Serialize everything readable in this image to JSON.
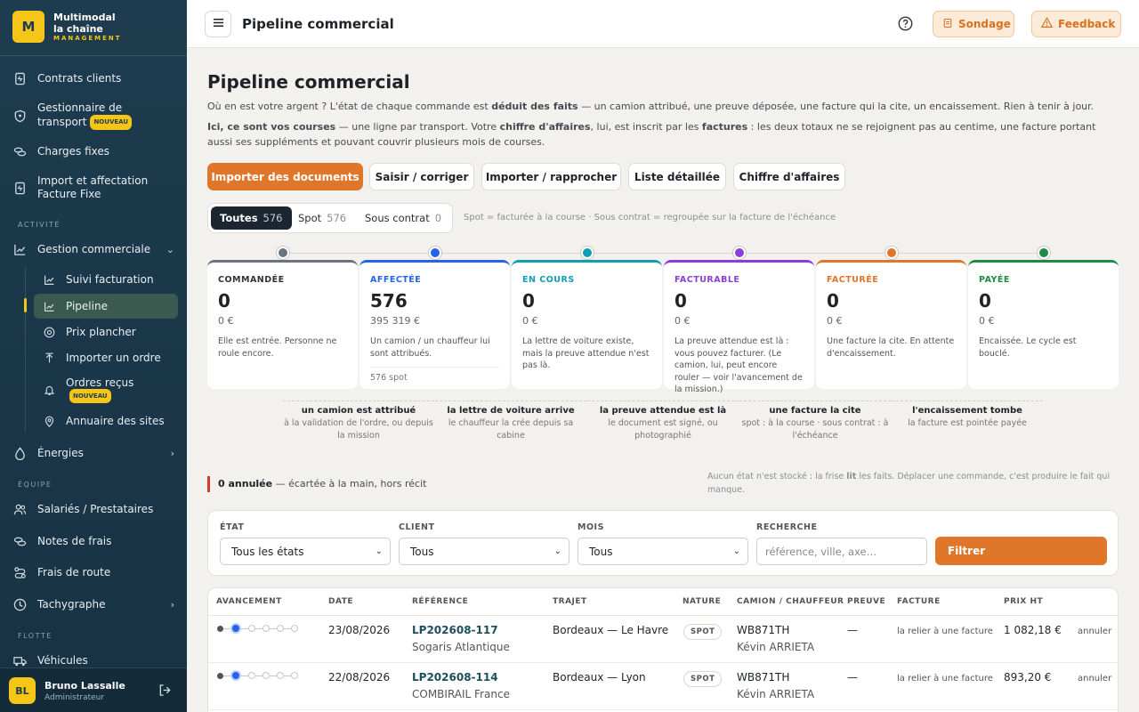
{
  "sidebar": {
    "logo": {
      "mark": "M",
      "line1": "Multimodal",
      "line2": "la chaîne",
      "line3": "MANAGEMENT"
    },
    "top_items": [
      {
        "label": "Contrats clients"
      },
      {
        "label": "Gestionnaire de transport",
        "badge": "NOUVEAU"
      },
      {
        "label": "Charges fixes"
      },
      {
        "label": "Import et affectation Facture Fixe"
      }
    ],
    "section_activite": "ACTIVITÉ",
    "gestion_commerciale": "Gestion commerciale",
    "sub_items": [
      {
        "label": "Suivi facturation"
      },
      {
        "label": "Pipeline"
      },
      {
        "label": "Prix plancher"
      },
      {
        "label": "Importer un ordre"
      },
      {
        "label": "Ordres reçus",
        "badge": "NOUVEAU"
      },
      {
        "label": "Annuaire des sites"
      }
    ],
    "energies": "Énergies",
    "section_equipe": "ÉQUIPE",
    "equipe_items": [
      {
        "label": "Salariés / Prestataires"
      },
      {
        "label": "Notes de frais"
      },
      {
        "label": "Frais de route"
      },
      {
        "label": "Tachygraphe"
      }
    ],
    "section_flotte": "FLOTTE",
    "vehicules": "Véhicules",
    "user": {
      "initials": "BL",
      "name": "Bruno Lassalle",
      "role": "Administrateur"
    }
  },
  "topbar": {
    "title": "Pipeline commercial",
    "sondage": "Sondage",
    "feedback": "Feedback"
  },
  "page": {
    "title": "Pipeline commercial",
    "intro_1a": "Où en est votre argent ? L'état de chaque commande est ",
    "intro_1b": "déduit des faits",
    "intro_1c": " — un camion attribué, une preuve déposée, une facture qui la cite, un encaissement. Rien à tenir à jour.",
    "intro_2a": "Ici, ce sont vos courses",
    "intro_2b": " — une ligne par transport. Votre ",
    "intro_2c": "chiffre d'affaires",
    "intro_2d": ", lui, est inscrit par les ",
    "intro_2e": "factures",
    "intro_2f": " : les deux totaux ne se rejoignent pas au centime, une facture portant aussi ses suppléments et pouvant couvrir plusieurs mois de courses.",
    "actions": [
      "Importer des documents",
      "Saisir / corriger",
      "Importer / rapprocher",
      "Liste détaillée",
      "Chiffre d'affaires"
    ],
    "segments": [
      {
        "label": "Toutes",
        "count": "576"
      },
      {
        "label": "Spot",
        "count": "576"
      },
      {
        "label": "Sous contrat",
        "count": "0"
      }
    ],
    "segment_note": "Spot = facturée à la course · Sous contrat = regroupée sur la facture de l'échéance",
    "stages": [
      {
        "status": "COMMANDÉE",
        "count": "0",
        "amount": "0 €",
        "desc": "Elle est entrée. Personne ne roule encore.",
        "color": "#6b7280"
      },
      {
        "status": "AFFECTÉE",
        "count": "576",
        "amount": "395 319 €",
        "desc": "Un camion / un chauffeur lui sont attribués.",
        "extra": "576 spot",
        "color": "#2563eb"
      },
      {
        "status": "EN COURS",
        "count": "0",
        "amount": "0 €",
        "desc": "La lettre de voiture existe, mais la preuve attendue n'est pas là.",
        "color": "#0e9fb4"
      },
      {
        "status": "FACTURABLE",
        "count": "0",
        "amount": "0 €",
        "desc": "La preuve attendue est là : vous pouvez facturer. (Le camion, lui, peut encore rouler — voir l'avancement de la mission.)",
        "color": "#8b3fd9"
      },
      {
        "status": "FACTURÉE",
        "count": "0",
        "amount": "0 €",
        "desc": "Une facture la cite. En attente d'encaissement.",
        "color": "#e0762a"
      },
      {
        "status": "PAYÉE",
        "count": "0",
        "amount": "0 €",
        "desc": "Encaissée. Le cycle est bouclé.",
        "color": "#1e8a45"
      }
    ],
    "transitions": [
      {
        "title": "un camion est attribué",
        "desc": "à la validation de l'ordre, ou depuis la mission"
      },
      {
        "title": "la lettre de voiture arrive",
        "desc": "le chauffeur la crée depuis sa cabine"
      },
      {
        "title": "la preuve attendue est là",
        "desc": "le document est signé, ou photographié"
      },
      {
        "title": "une facture la cite",
        "desc": "spot : à la course · sous contrat : à l'échéance"
      },
      {
        "title": "l'encaissement tombe",
        "desc": "la facture est pointée payée"
      }
    ],
    "cancelled_count": "0 annulée",
    "cancelled_desc": " — écartée à la main, hors récit",
    "note_right_a": "Aucun état n'est stocké : la frise ",
    "note_right_b": "lit",
    "note_right_c": " les faits. Déplacer une commande, c'est produire le fait qui manque."
  },
  "filters": {
    "etat_label": "ÉTAT",
    "etat_value": "Tous les états",
    "client_label": "CLIENT",
    "client_value": "Tous",
    "mois_label": "MOIS",
    "mois_value": "Tous",
    "recherche_label": "RECHERCHE",
    "recherche_placeholder": "référence, ville, axe…",
    "button": "Filtrer"
  },
  "table": {
    "headers": [
      "AVANCEMENT",
      "DATE",
      "RÉFÉRENCE",
      "TRAJET",
      "NATURE",
      "CAMION / CHAUFFEUR",
      "PREUVE",
      "FACTURE",
      "PRIX HT"
    ],
    "rows": [
      {
        "date": "23/08/2026",
        "ref": "LP202608-117",
        "client": "Sogaris Atlantique",
        "trajet": "Bordeaux — Le Havre",
        "nature": "SPOT",
        "camion": "WB871TH",
        "chauffeur": "Kévin ARRIETA",
        "preuve": "—",
        "facture": "la relier à une facture",
        "prix": "1 082,18 €",
        "action": "annuler"
      },
      {
        "date": "22/08/2026",
        "ref": "LP202608-114",
        "client": "COMBIRAIL France",
        "trajet": "Bordeaux — Lyon",
        "nature": "SPOT",
        "camion": "WB871TH",
        "chauffeur": "Kévin ARRIETA",
        "preuve": "—",
        "facture": "la relier à une facture",
        "prix": "893,20 €",
        "action": "annuler"
      }
    ]
  }
}
